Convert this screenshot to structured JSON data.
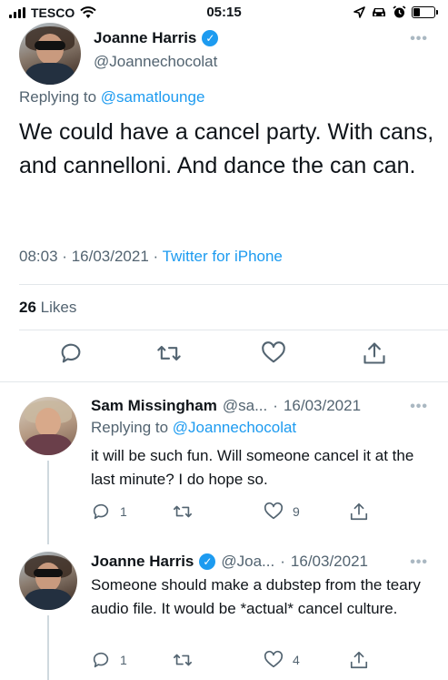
{
  "status_bar": {
    "carrier": "TESCO",
    "time": "05:15",
    "battery_level": 0.3
  },
  "main_tweet": {
    "author_name": "Joanne Harris",
    "author_handle": "@Joannechocolat",
    "replying_prefix": "Replying to",
    "replying_to": "@samatlounge",
    "text": "We could have a cancel party. With cans, and cannelloni. And dance the can can.",
    "time": "08:03",
    "date": "16/03/2021",
    "separator": "·",
    "source": "Twitter for iPhone",
    "likes_count": "26",
    "likes_label": "Likes",
    "icons": [
      "reply-icon",
      "retweet-icon",
      "like-icon",
      "share-icon"
    ]
  },
  "replies": [
    {
      "author_name": "Sam Missingham",
      "author_handle": "@sa...",
      "separator": "·",
      "date": "16/03/2021",
      "replying_prefix": "Replying to",
      "replying_to": "@Joannechocolat",
      "text": "it will be such fun. Will someone cancel it at the last minute? I do hope so.",
      "reply_count": "1",
      "like_count": "9"
    },
    {
      "author_name": "Joanne Harris",
      "author_handle": "@Joa...",
      "separator": "·",
      "date": "16/03/2021",
      "text": "Someone should make a dubstep from the teary audio file. It would be *actual* cancel culture.",
      "reply_count": "1",
      "like_count": "4"
    }
  ],
  "colors": {
    "accent": "#1d9bf0",
    "secondary_text": "#536471",
    "primary_text": "#0f1419"
  }
}
